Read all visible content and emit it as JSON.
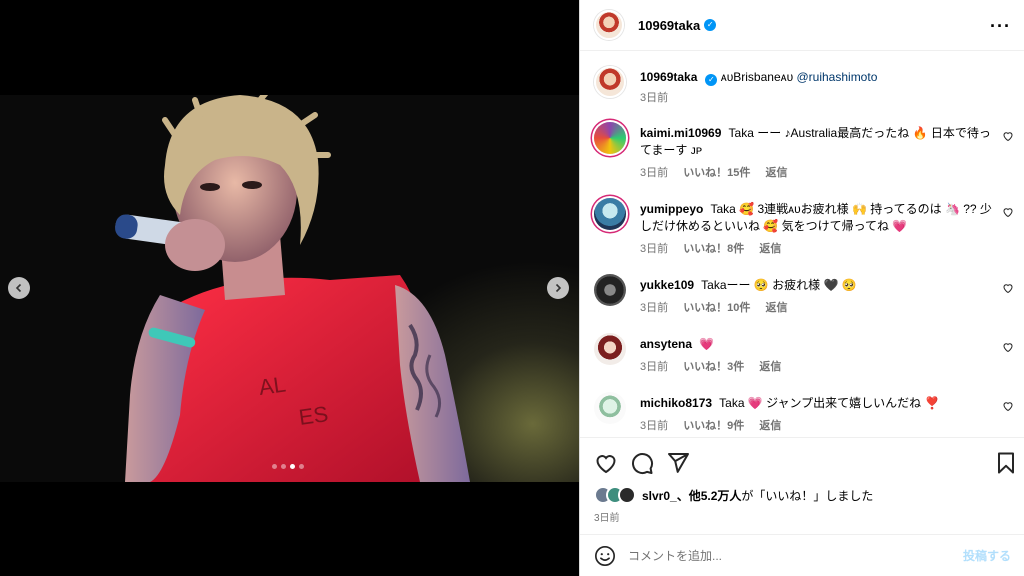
{
  "post": {
    "author": "10969taka",
    "caption_prefix": "ᴀᴜBrisbaneᴀᴜ",
    "caption_mention": "@ruihashimoto",
    "caption_time": "3日前"
  },
  "comments": [
    {
      "user": "kaimi.mi10969",
      "text": "Taka ーー ♪Australia最高だったね 🔥 日本で待ってまーす ᴊᴘ",
      "time": "3日前",
      "likes": "いいね！15件",
      "reply": "返信"
    },
    {
      "user": "yumippeyo",
      "text": "Taka 🥰 3連戦ᴀᴜお疲れ様 🙌 持ってるのは 🦄 ?? 少しだけ休めるといいね 🥰 気をつけて帰ってね 💗",
      "time": "3日前",
      "likes": "いいね！8件",
      "reply": "返信"
    },
    {
      "user": "yukke109",
      "text": "Takaーー 🥺 お疲れ様 🖤 🥺",
      "time": "3日前",
      "likes": "いいね！10件",
      "reply": "返信"
    },
    {
      "user": "ansytena",
      "text": "💗",
      "time": "3日前",
      "likes": "いいね！3件",
      "reply": "返信"
    },
    {
      "user": "michiko8173",
      "text": "Taka 💗 ジャンプ出来て嬉しいんだね ❣️",
      "time": "3日前",
      "likes": "いいね！9件",
      "reply": "返信"
    }
  ],
  "footer": {
    "liked_by_user": "slvr0_",
    "liked_by_rest": "、他5.2万人",
    "liked_by_suffix": "が「いいね！」しました",
    "date": "3日前",
    "comment_placeholder": "コメントを追加...",
    "post_button": "投稿する"
  },
  "colors": {
    "link": "#00376b",
    "verified": "#0095f6",
    "post_button_disabled": "#b2dffc",
    "heart": "#ed4956"
  },
  "icons": [
    "more-options-icon",
    "heart-icon",
    "comment-icon",
    "share-icon",
    "bookmark-icon",
    "emoji-icon",
    "chevron-left-icon",
    "chevron-right-icon",
    "verified-icon"
  ]
}
